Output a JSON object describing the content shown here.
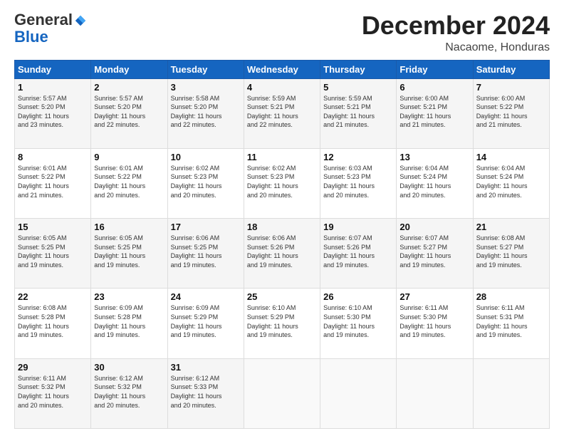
{
  "header": {
    "logo_general": "General",
    "logo_blue": "Blue",
    "month_title": "December 2024",
    "location": "Nacaome, Honduras"
  },
  "days_of_week": [
    "Sunday",
    "Monday",
    "Tuesday",
    "Wednesday",
    "Thursday",
    "Friday",
    "Saturday"
  ],
  "weeks": [
    [
      {
        "day": "1",
        "info": "Sunrise: 5:57 AM\nSunset: 5:20 PM\nDaylight: 11 hours\nand 23 minutes."
      },
      {
        "day": "2",
        "info": "Sunrise: 5:57 AM\nSunset: 5:20 PM\nDaylight: 11 hours\nand 22 minutes."
      },
      {
        "day": "3",
        "info": "Sunrise: 5:58 AM\nSunset: 5:20 PM\nDaylight: 11 hours\nand 22 minutes."
      },
      {
        "day": "4",
        "info": "Sunrise: 5:59 AM\nSunset: 5:21 PM\nDaylight: 11 hours\nand 22 minutes."
      },
      {
        "day": "5",
        "info": "Sunrise: 5:59 AM\nSunset: 5:21 PM\nDaylight: 11 hours\nand 21 minutes."
      },
      {
        "day": "6",
        "info": "Sunrise: 6:00 AM\nSunset: 5:21 PM\nDaylight: 11 hours\nand 21 minutes."
      },
      {
        "day": "7",
        "info": "Sunrise: 6:00 AM\nSunset: 5:22 PM\nDaylight: 11 hours\nand 21 minutes."
      }
    ],
    [
      {
        "day": "8",
        "info": "Sunrise: 6:01 AM\nSunset: 5:22 PM\nDaylight: 11 hours\nand 21 minutes."
      },
      {
        "day": "9",
        "info": "Sunrise: 6:01 AM\nSunset: 5:22 PM\nDaylight: 11 hours\nand 20 minutes."
      },
      {
        "day": "10",
        "info": "Sunrise: 6:02 AM\nSunset: 5:23 PM\nDaylight: 11 hours\nand 20 minutes."
      },
      {
        "day": "11",
        "info": "Sunrise: 6:02 AM\nSunset: 5:23 PM\nDaylight: 11 hours\nand 20 minutes."
      },
      {
        "day": "12",
        "info": "Sunrise: 6:03 AM\nSunset: 5:23 PM\nDaylight: 11 hours\nand 20 minutes."
      },
      {
        "day": "13",
        "info": "Sunrise: 6:04 AM\nSunset: 5:24 PM\nDaylight: 11 hours\nand 20 minutes."
      },
      {
        "day": "14",
        "info": "Sunrise: 6:04 AM\nSunset: 5:24 PM\nDaylight: 11 hours\nand 20 minutes."
      }
    ],
    [
      {
        "day": "15",
        "info": "Sunrise: 6:05 AM\nSunset: 5:25 PM\nDaylight: 11 hours\nand 19 minutes."
      },
      {
        "day": "16",
        "info": "Sunrise: 6:05 AM\nSunset: 5:25 PM\nDaylight: 11 hours\nand 19 minutes."
      },
      {
        "day": "17",
        "info": "Sunrise: 6:06 AM\nSunset: 5:25 PM\nDaylight: 11 hours\nand 19 minutes."
      },
      {
        "day": "18",
        "info": "Sunrise: 6:06 AM\nSunset: 5:26 PM\nDaylight: 11 hours\nand 19 minutes."
      },
      {
        "day": "19",
        "info": "Sunrise: 6:07 AM\nSunset: 5:26 PM\nDaylight: 11 hours\nand 19 minutes."
      },
      {
        "day": "20",
        "info": "Sunrise: 6:07 AM\nSunset: 5:27 PM\nDaylight: 11 hours\nand 19 minutes."
      },
      {
        "day": "21",
        "info": "Sunrise: 6:08 AM\nSunset: 5:27 PM\nDaylight: 11 hours\nand 19 minutes."
      }
    ],
    [
      {
        "day": "22",
        "info": "Sunrise: 6:08 AM\nSunset: 5:28 PM\nDaylight: 11 hours\nand 19 minutes."
      },
      {
        "day": "23",
        "info": "Sunrise: 6:09 AM\nSunset: 5:28 PM\nDaylight: 11 hours\nand 19 minutes."
      },
      {
        "day": "24",
        "info": "Sunrise: 6:09 AM\nSunset: 5:29 PM\nDaylight: 11 hours\nand 19 minutes."
      },
      {
        "day": "25",
        "info": "Sunrise: 6:10 AM\nSunset: 5:29 PM\nDaylight: 11 hours\nand 19 minutes."
      },
      {
        "day": "26",
        "info": "Sunrise: 6:10 AM\nSunset: 5:30 PM\nDaylight: 11 hours\nand 19 minutes."
      },
      {
        "day": "27",
        "info": "Sunrise: 6:11 AM\nSunset: 5:30 PM\nDaylight: 11 hours\nand 19 minutes."
      },
      {
        "day": "28",
        "info": "Sunrise: 6:11 AM\nSunset: 5:31 PM\nDaylight: 11 hours\nand 19 minutes."
      }
    ],
    [
      {
        "day": "29",
        "info": "Sunrise: 6:11 AM\nSunset: 5:32 PM\nDaylight: 11 hours\nand 20 minutes."
      },
      {
        "day": "30",
        "info": "Sunrise: 6:12 AM\nSunset: 5:32 PM\nDaylight: 11 hours\nand 20 minutes."
      },
      {
        "day": "31",
        "info": "Sunrise: 6:12 AM\nSunset: 5:33 PM\nDaylight: 11 hours\nand 20 minutes."
      },
      {
        "day": "",
        "info": ""
      },
      {
        "day": "",
        "info": ""
      },
      {
        "day": "",
        "info": ""
      },
      {
        "day": "",
        "info": ""
      }
    ]
  ]
}
